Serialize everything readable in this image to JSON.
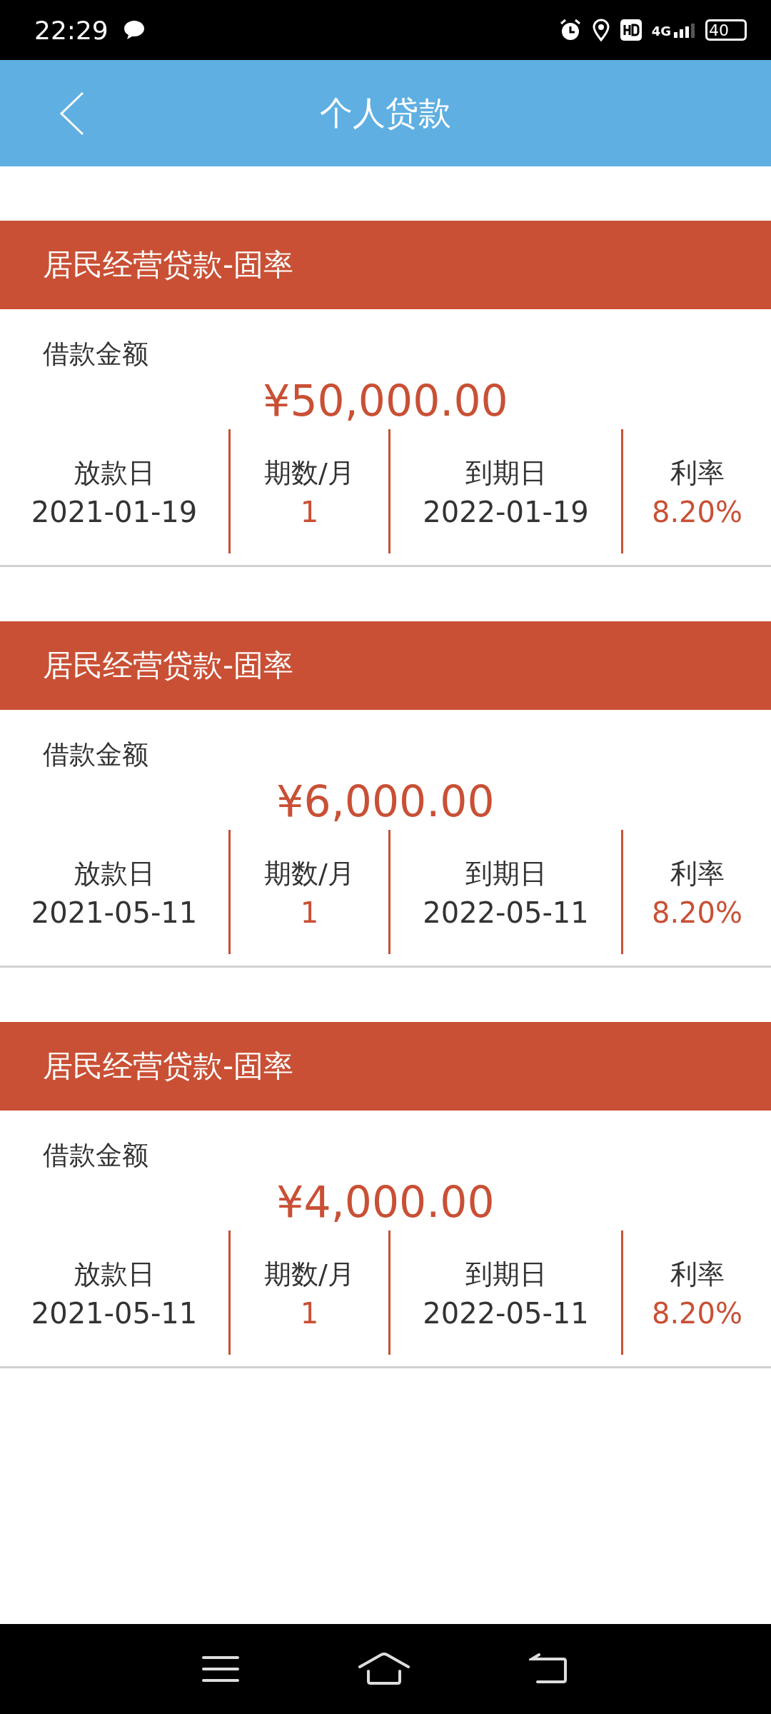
{
  "status_bar": {
    "time": "22:29",
    "network": "4G",
    "battery": "40"
  },
  "header": {
    "title": "个人贷款"
  },
  "loans": [
    {
      "title": "居民经营贷款-固率",
      "amount_label": "借款金额",
      "amount": "¥50,000.00",
      "fields": [
        {
          "label": "放款日",
          "value": "2021-01-19",
          "highlight": false
        },
        {
          "label": "期数/月",
          "value": "1",
          "highlight": true
        },
        {
          "label": "到期日",
          "value": "2022-01-19",
          "highlight": false
        },
        {
          "label": "利率",
          "value": "8.20%",
          "highlight": true
        }
      ]
    },
    {
      "title": "居民经营贷款-固率",
      "amount_label": "借款金额",
      "amount": "¥6,000.00",
      "fields": [
        {
          "label": "放款日",
          "value": "2021-05-11",
          "highlight": false
        },
        {
          "label": "期数/月",
          "value": "1",
          "highlight": true
        },
        {
          "label": "到期日",
          "value": "2022-05-11",
          "highlight": false
        },
        {
          "label": "利率",
          "value": "8.20%",
          "highlight": true
        }
      ]
    },
    {
      "title": "居民经营贷款-固率",
      "amount_label": "借款金额",
      "amount": "¥4,000.00",
      "fields": [
        {
          "label": "放款日",
          "value": "2021-05-11",
          "highlight": false
        },
        {
          "label": "期数/月",
          "value": "1",
          "highlight": true
        },
        {
          "label": "到期日",
          "value": "2022-05-11",
          "highlight": false
        },
        {
          "label": "利率",
          "value": "8.20%",
          "highlight": true
        }
      ]
    }
  ]
}
